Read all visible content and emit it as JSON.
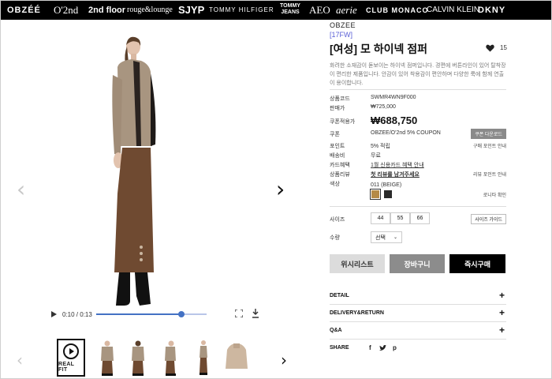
{
  "brand_bar": {
    "brands": [
      "OBZÉÉ",
      "O'2nd",
      "2nd floor",
      "rouge&lounge",
      "SJYP",
      "TOMMY HILFIGER",
      "TOMMY JEANS",
      "AEO",
      "aerie",
      "CLUB MONACO",
      "CALVIN KLEIN",
      "DKNY"
    ]
  },
  "viewer": {
    "video": {
      "time": "0:10 / 0:13",
      "progress": 0.77
    },
    "thumbnails": {
      "realfit_label": "REAL FIT"
    }
  },
  "product": {
    "brand": "OBZEE",
    "season": "[17FW]",
    "title": "[여성] 모 하이넥 점퍼",
    "likes": "15",
    "description": "화려한 소재감이 돋보이는 하이넥 점퍼입니다. 경편에 버튼라인이 있어 탈착장이 편리한 제품입니다. 안감이 있어 착용감이 편안하며 다양한 룩에 함께 연출이 용이합니다.",
    "info": [
      {
        "label": "상품코드",
        "value": "SWMR4WN9F000",
        "side": ""
      },
      {
        "label": "판매가",
        "value": "₩725,000",
        "side": ""
      },
      {
        "label": "쿠폰적용가",
        "value": "₩688,750",
        "side": ""
      },
      {
        "label": "쿠폰",
        "value": "OBZEE/O'2nd 5% COUPON",
        "side": "쿠폰 다운로드"
      },
      {
        "label": "포인트",
        "value": "5% 적립",
        "side": "구매 포인트 안내"
      },
      {
        "label": "배송비",
        "value": "무료",
        "side": ""
      },
      {
        "label": "카드혜택",
        "value": "1월 신용카드 혜택 안내",
        "side": ""
      },
      {
        "label": "상품리뷰",
        "value": "첫 리뷰를 남겨주세요",
        "side": "리뷰 포인트 안내"
      },
      {
        "label": "색상",
        "value": "011 (BEIGE)",
        "side": "로니타 확인"
      }
    ],
    "size": {
      "label": "사이즈",
      "options": [
        "44",
        "55",
        "66"
      ],
      "guide": "사이즈 가이드"
    },
    "quantity": {
      "label": "수량",
      "selected": "선택"
    },
    "buttons": {
      "wishlist": "위시리스트",
      "cart": "장바구니",
      "buy": "즉시구매"
    },
    "accordion": [
      "DETAIL",
      "DELIVERY&RETURN",
      "Q&A"
    ],
    "share": {
      "label": "SHARE",
      "icons": [
        "f",
        "t",
        "p"
      ]
    },
    "colors": {
      "swatches": [
        "#b58a47",
        "#2a2a2a"
      ],
      "season_link": "#5a5fd6"
    }
  }
}
